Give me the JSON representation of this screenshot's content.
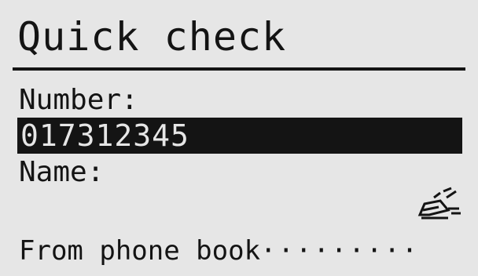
{
  "screen": {
    "title": "Quick check",
    "number_label": "Number:",
    "number_value": "017312345",
    "name_label": "Name:",
    "name_value": "",
    "edit_icon": "edit-pencil-icon",
    "softkey_label": "From phone book",
    "softkey_dots": "·········"
  },
  "colors": {
    "background": "#e6e6e6",
    "foreground": "#141414"
  }
}
